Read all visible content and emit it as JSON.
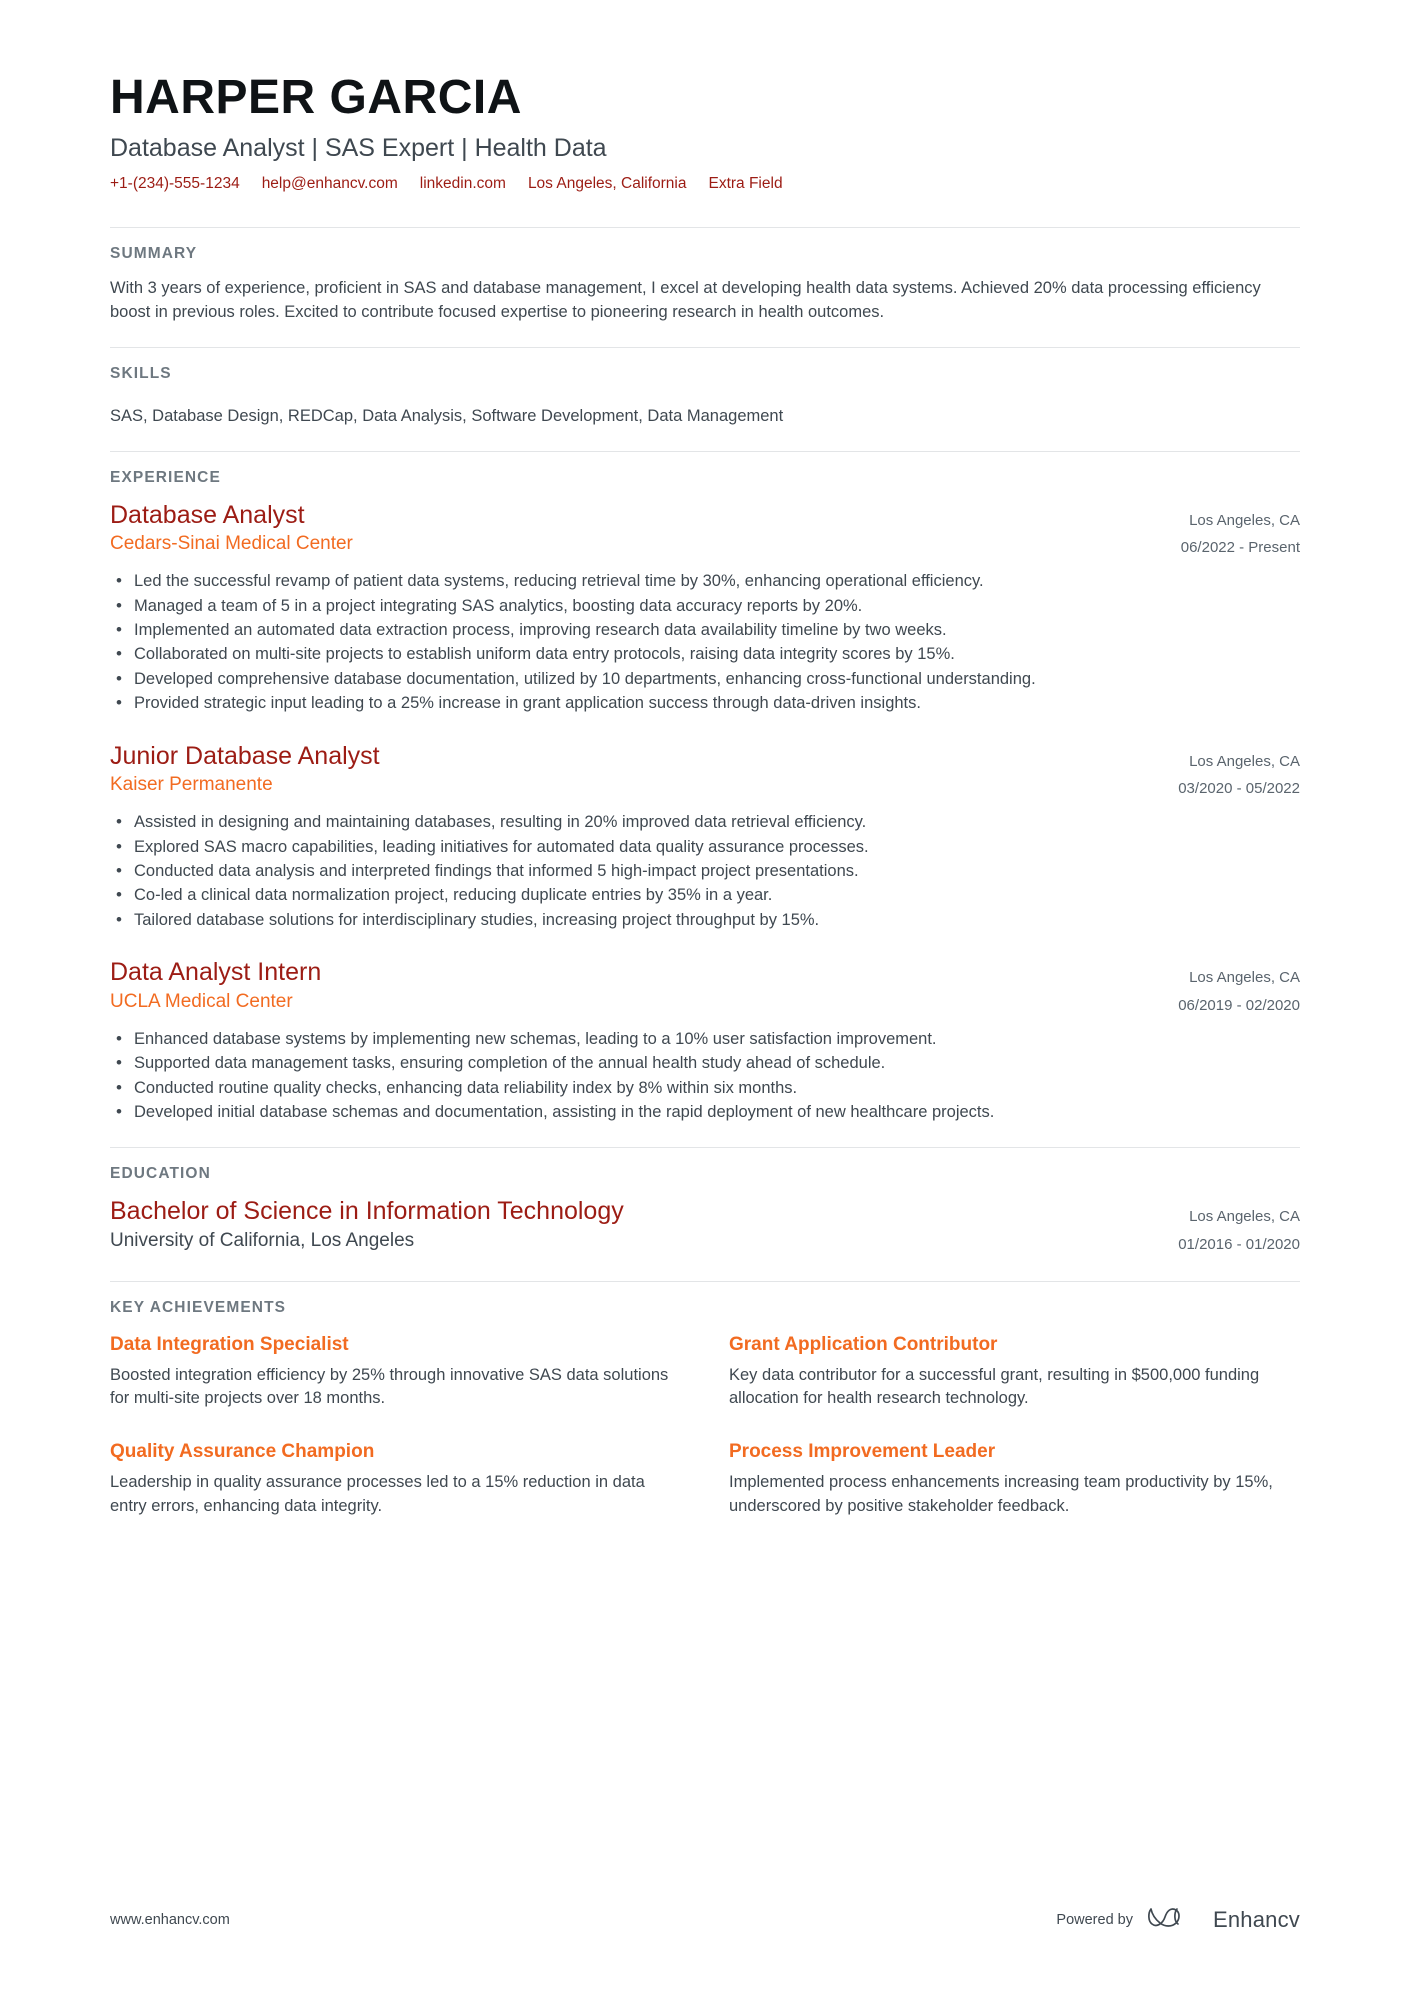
{
  "header": {
    "full_name": "Harper Garcia",
    "headline": "Database Analyst | SAS Expert | Health Data",
    "contacts": [
      {
        "name": "phone",
        "text": "+1-(234)-555-1234"
      },
      {
        "name": "email",
        "text": "help@enhancv.com"
      },
      {
        "name": "linkedin",
        "text": "linkedin.com"
      },
      {
        "name": "location",
        "text": "Los Angeles, California"
      },
      {
        "name": "extra-field",
        "text": "Extra Field"
      }
    ],
    "accent_color": "#9c1c14"
  },
  "summary": {
    "title": "Summary",
    "text": "With 3 years of experience, proficient in SAS and database management, I excel at developing health data systems. Achieved 20% data processing efficiency boost in previous roles. Excited to contribute focused expertise to pioneering research in health outcomes."
  },
  "skills": {
    "title": "Skills",
    "text": "SAS, Database Design, REDCap, Data Analysis, Software Development, Data Management"
  },
  "experience": {
    "title": "Experience",
    "entries": [
      {
        "role": "Database Analyst",
        "company": "Cedars-Sinai Medical Center",
        "location": "Los Angeles, CA",
        "dates": "06/2022 - Present",
        "bullets": [
          "Led the successful revamp of patient data systems, reducing retrieval time by 30%, enhancing operational efficiency.",
          "Managed a team of 5 in a project integrating SAS analytics, boosting data accuracy reports by 20%.",
          "Implemented an automated data extraction process, improving research data availability timeline by two weeks.",
          "Collaborated on multi-site projects to establish uniform data entry protocols, raising data integrity scores by 15%.",
          "Developed comprehensive database documentation, utilized by 10 departments, enhancing cross-functional understanding.",
          "Provided strategic input leading to a 25% increase in grant application success through data-driven insights."
        ]
      },
      {
        "role": "Junior Database Analyst",
        "company": "Kaiser Permanente",
        "location": "Los Angeles, CA",
        "dates": "03/2020 - 05/2022",
        "bullets": [
          "Assisted in designing and maintaining databases, resulting in 20% improved data retrieval efficiency.",
          "Explored SAS macro capabilities, leading initiatives for automated data quality assurance processes.",
          "Conducted data analysis and interpreted findings that informed 5 high-impact project presentations.",
          "Co-led a clinical data normalization project, reducing duplicate entries by 35% in a year.",
          "Tailored database solutions for interdisciplinary studies, increasing project throughput by 15%."
        ]
      },
      {
        "role": "Data Analyst Intern",
        "company": "UCLA Medical Center",
        "location": "Los Angeles, CA",
        "dates": "06/2019 - 02/2020",
        "bullets": [
          "Enhanced database systems by implementing new schemas, leading to a 10% user satisfaction improvement.",
          "Supported data management tasks, ensuring completion of the annual health study ahead of schedule.",
          "Conducted routine quality checks, enhancing data reliability index by 8% within six months.",
          "Developed initial database schemas and documentation, assisting in the rapid deployment of new healthcare projects."
        ]
      }
    ]
  },
  "education": {
    "title": "Education",
    "entries": [
      {
        "degree": "Bachelor of Science in Information Technology",
        "school": "University of California, Los Angeles",
        "location": "Los Angeles, CA",
        "dates": "01/2016 - 01/2020"
      }
    ]
  },
  "key_achievements": {
    "title": "Key Achievements",
    "items": [
      {
        "title": "Data Integration Specialist",
        "description": "Boosted integration efficiency by 25% through innovative SAS data solutions for multi-site projects over 18 months."
      },
      {
        "title": "Grant Application Contributor",
        "description": "Key data contributor for a successful grant, resulting in $500,000 funding allocation for health research technology."
      },
      {
        "title": "Quality Assurance Champion",
        "description": "Leadership in quality assurance processes led to a 15% reduction in data entry errors, enhancing data integrity."
      },
      {
        "title": "Process Improvement Leader",
        "description": "Implemented process enhancements increasing team productivity by 15%, underscored by positive stakeholder feedback."
      }
    ]
  },
  "footer": {
    "url": "www.enhancv.com",
    "powered_by": "Powered by",
    "brand": "Enhancv"
  },
  "colors": {
    "title_red": "#9c1c14",
    "accent_orange": "#f26b21",
    "body_gray": "#3f4850",
    "section_label": "#6e7880"
  }
}
